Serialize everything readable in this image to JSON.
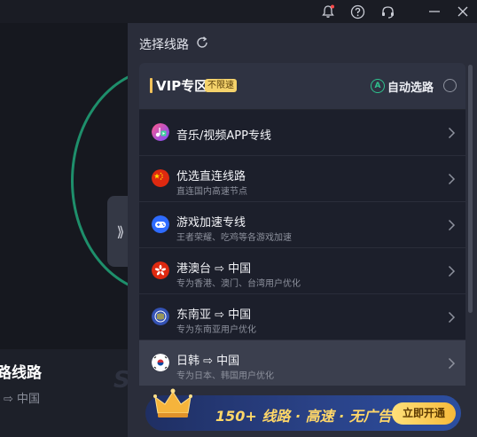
{
  "titlebar": {
    "icons": [
      "bell-icon",
      "help-icon",
      "headset-icon",
      "minimize-icon",
      "close-icon"
    ]
  },
  "background": {
    "route_label": "路线路",
    "sub_label": "⇨ 中国",
    "ring_color": "#1e8f6b"
  },
  "panel": {
    "title": "选择线路",
    "vip": {
      "title": "VIP专区",
      "badge": "不限速",
      "auto_icon": "A",
      "auto_label": "自动选路"
    },
    "routes": [
      {
        "name": "音乐/视频APP专线",
        "desc": "",
        "icon": "music-video-icon",
        "selected": false
      },
      {
        "name": "优选直连线路",
        "desc": "直连国内高速节点",
        "icon": "china-flag-icon",
        "selected": false
      },
      {
        "name": "游戏加速专线",
        "desc": "王者荣耀、吃鸡等各游戏加速",
        "icon": "gamepad-icon",
        "selected": false
      },
      {
        "name": "港澳台 ⇨ 中国",
        "desc": "专为香港、澳门、台湾用户优化",
        "icon": "hongkong-flag-icon",
        "selected": false
      },
      {
        "name": "东南亚 ⇨ 中国",
        "desc": "专为东南亚用户优化",
        "icon": "asean-icon",
        "selected": false
      },
      {
        "name": "日韩 ⇨ 中国",
        "desc": "专为日本、韩国用户优化",
        "icon": "korea-flag-icon",
        "selected": true
      }
    ],
    "promo": {
      "text": "150+ 线路 · 高速 · 无广告",
      "button": "立即开通"
    }
  },
  "colors": {
    "accent_green": "#2fc28e",
    "vip_gold": "#f4d26b",
    "promo_text": "#ffd768"
  }
}
